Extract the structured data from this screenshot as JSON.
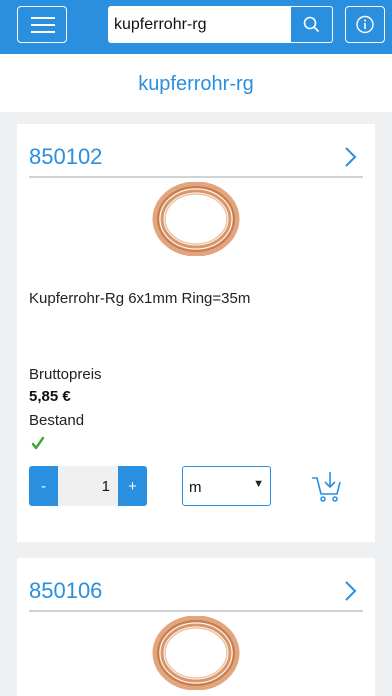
{
  "header": {
    "search_value": "kupferrohr-rg",
    "icons": {
      "menu": "hamburger-menu-icon",
      "search": "search-icon",
      "info": "info-icon"
    }
  },
  "page": {
    "title": "kupferrohr-rg"
  },
  "products": [
    {
      "number": "850102",
      "description": "Kupferrohr-Rg 6x1mm Ring=35m",
      "price_label": "Bruttopreis",
      "price": "5,85 €",
      "stock_label": "Bestand",
      "in_stock": true,
      "quantity": "1",
      "minus_label": "-",
      "plus_label": "+",
      "unit": "m"
    },
    {
      "number": "850106"
    }
  ],
  "colors": {
    "accent": "#2a8fdf",
    "background": "#eef0f2",
    "stock_ok": "#3aa832",
    "copper": "#d9966a"
  }
}
